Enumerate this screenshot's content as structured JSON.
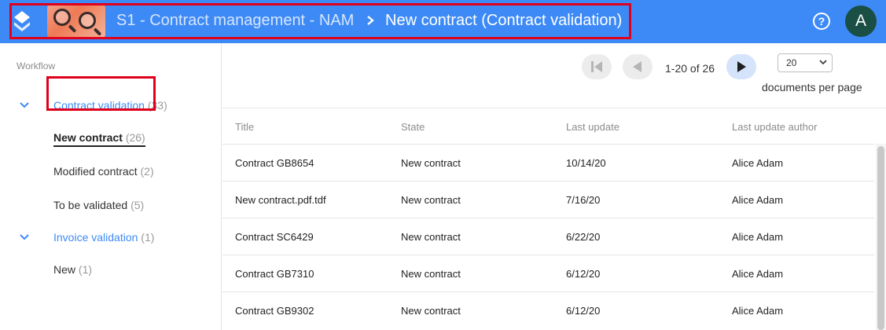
{
  "header": {
    "app_title": "S1 - Contract management - NAM",
    "separator": "›",
    "current_view": "New contract (Contract validation)",
    "help_label": "?",
    "avatar_initial": "A",
    "brand_color": "#3d8af7",
    "highlight_color": "#e0001b"
  },
  "sidebar": {
    "title": "Workflow",
    "groups": [
      {
        "label": "Contract validation",
        "count": "(33)",
        "items": [
          {
            "label": "New contract",
            "count": "(26)"
          },
          {
            "label": "Modified contract",
            "count": "(2)"
          },
          {
            "label": "To be validated",
            "count": "(5)"
          }
        ]
      },
      {
        "label": "Invoice validation",
        "count": "(1)",
        "items": [
          {
            "label": "New",
            "count": "(1)"
          }
        ]
      }
    ]
  },
  "pager": {
    "range_text": "1-20 of 26",
    "per_page_value": "20",
    "per_page_label": "documents per page"
  },
  "table": {
    "headers": [
      "Title",
      "State",
      "Last update",
      "Last update author"
    ],
    "rows": [
      [
        "Contract GB8654",
        "New contract",
        "10/14/20",
        "Alice Adam"
      ],
      [
        "New contract.pdf.tdf",
        "New contract",
        "7/16/20",
        "Alice Adam"
      ],
      [
        "Contract SC6429",
        "New contract",
        "6/22/20",
        "Alice Adam"
      ],
      [
        "Contract GB7310",
        "New contract",
        "6/12/20",
        "Alice Adam"
      ],
      [
        "Contract GB9302",
        "New contract",
        "6/12/20",
        "Alice Adam"
      ]
    ]
  }
}
